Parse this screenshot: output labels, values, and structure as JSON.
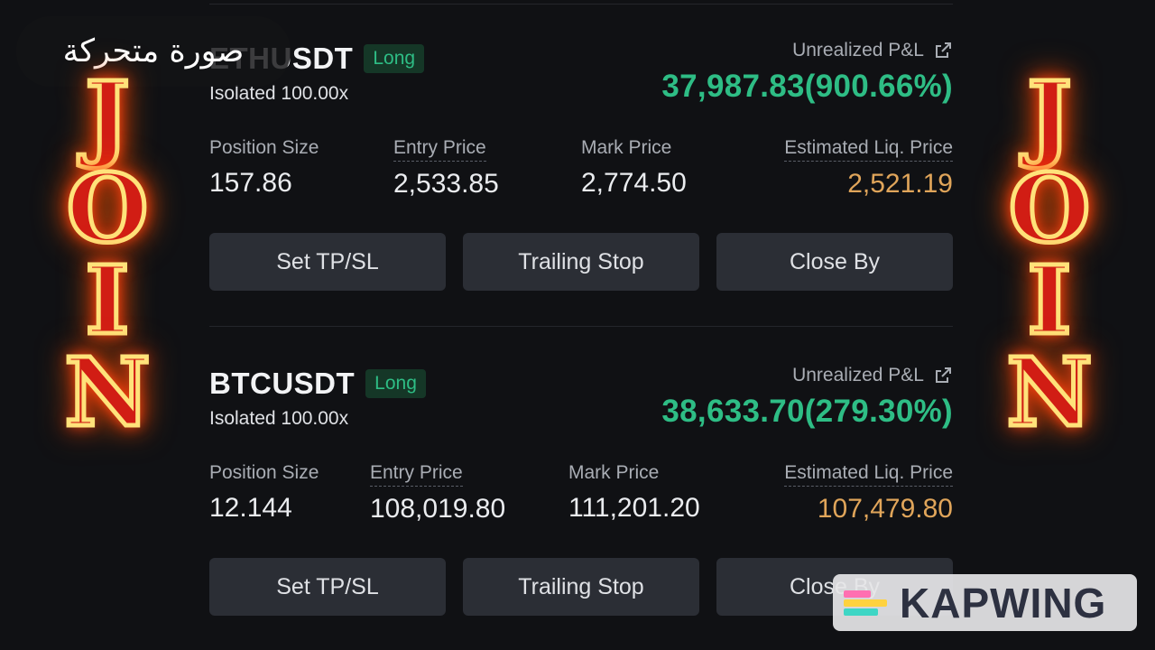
{
  "overlay": {
    "gif_badge": "صورة متحركة",
    "join_letters": [
      "J",
      "O",
      "I",
      "N"
    ],
    "watermark": "KAPWING"
  },
  "labels": {
    "unrealized_pnl": "Unrealized P&L",
    "position_size": "Position Size",
    "entry_price": "Entry Price",
    "mark_price": "Mark Price",
    "est_liq_price": "Estimated Liq. Price"
  },
  "buttons": {
    "set_tpsl": "Set TP/SL",
    "trailing_stop": "Trailing Stop",
    "close_by": "Close By"
  },
  "positions": [
    {
      "symbol": "ETHUSDT",
      "side": "Long",
      "margin_mode": "Isolated 100.00x",
      "unrealized_pnl": "37,987.83(900.66%)",
      "position_size": "157.86",
      "entry_price": "2,533.85",
      "mark_price": "2,774.50",
      "est_liq_price": "2,521.19"
    },
    {
      "symbol": "BTCUSDT",
      "side": "Long",
      "margin_mode": "Isolated 100.00x",
      "unrealized_pnl": "38,633.70(279.30%)",
      "position_size": "12.144",
      "entry_price": "108,019.80",
      "mark_price": "111,201.20",
      "est_liq_price": "107,479.80"
    }
  ],
  "colors": {
    "background": "#101114",
    "profit_green": "#2ebd85",
    "liq_orange": "#e0a55a",
    "button_bg": "#2b2e35"
  }
}
